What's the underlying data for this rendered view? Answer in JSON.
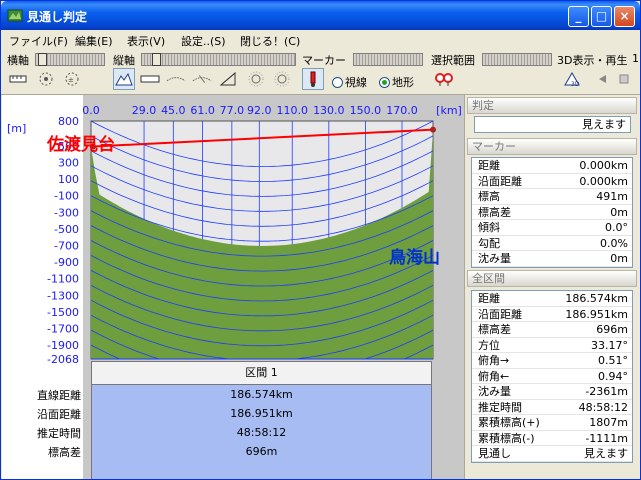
{
  "window": {
    "title": "見通し判定"
  },
  "menu": [
    "ファイル(F)",
    "編集(E)",
    "表示(V)",
    "設定..(S)",
    "閉じる！(C)"
  ],
  "toolbar": {
    "h_axis_label": "横軸",
    "v_axis_label": "縦軸",
    "marker_label": "マーカー",
    "range_label": "選択範囲",
    "view3d_label": "3D表示・再生",
    "view3d_value": "1",
    "radio_sight": "視線",
    "radio_terrain": "地形",
    "radio_selected": "terrain"
  },
  "chart_data": {
    "type": "area",
    "xlabel": "[km]",
    "ylabel": "[m]",
    "x_ticks": [
      "0.0",
      "29.0",
      "45.0",
      "61.0",
      "77.0",
      "92.0",
      "110.0",
      "130.0",
      "150.0",
      "170.0"
    ],
    "y_ticks": [
      "800",
      "500",
      "300",
      "100",
      "-100",
      "-300",
      "-500",
      "-700",
      "-900",
      "-1100",
      "-1300",
      "-1500",
      "-1700",
      "-1900",
      "-2068"
    ],
    "ylim": [
      -2068,
      800
    ],
    "xlim": [
      0,
      186.951
    ],
    "start_label": "佐渡見台",
    "end_label": "鳥海山",
    "line_of_sight": {
      "start": [
        0,
        491
      ],
      "end": [
        186.951,
        696
      ]
    },
    "terrain_colors": {
      "fill": "#6e9e3e",
      "grid": "#1e3cff",
      "sight": "#ff0000"
    }
  },
  "info": {
    "header": "区間 1",
    "labels": [
      "直線距離",
      "沿面距離",
      "推定時間",
      "標高差"
    ],
    "values": [
      "186.574km",
      "186.951km",
      "48:58:12",
      "696m"
    ]
  },
  "judge": {
    "title": "判定",
    "value": "見えます"
  },
  "marker": {
    "title": "マーカー",
    "rows": [
      {
        "k": "距離",
        "v": "0.000km"
      },
      {
        "k": "沿面距離",
        "v": "0.000km"
      },
      {
        "k": "標高",
        "v": "491m"
      },
      {
        "k": "標高差",
        "v": "0m"
      },
      {
        "k": "傾斜",
        "v": "0.0°"
      },
      {
        "k": "勾配",
        "v": "0.0%"
      },
      {
        "k": "沈み量",
        "v": "0m"
      }
    ]
  },
  "total": {
    "title": "全区間",
    "rows": [
      {
        "k": "距離",
        "v": "186.574km"
      },
      {
        "k": "沿面距離",
        "v": "186.951km"
      },
      {
        "k": "標高差",
        "v": "696m"
      },
      {
        "k": "方位",
        "v": "33.17°"
      },
      {
        "k": "俯角→",
        "v": "0.51°"
      },
      {
        "k": "俯角←",
        "v": "0.94°"
      },
      {
        "k": "沈み量",
        "v": "-2361m"
      },
      {
        "k": "推定時間",
        "v": "48:58:12"
      },
      {
        "k": "累積標高(+)",
        "v": "1807m"
      },
      {
        "k": "累積標高(-)",
        "v": "-1111m"
      },
      {
        "k": "見通し",
        "v": "見えます"
      }
    ]
  }
}
